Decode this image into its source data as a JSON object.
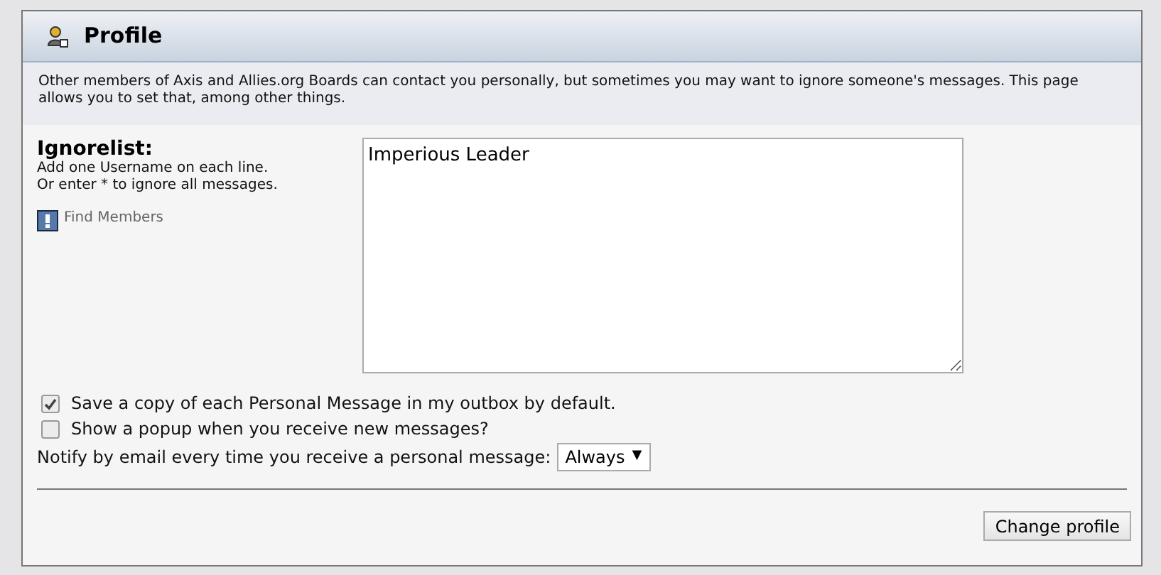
{
  "panel": {
    "title": "Profile",
    "intro": "Other members of Axis and Allies.org Boards can contact you personally, but sometimes you may want to ignore someone's messages. This page allows you to set that, among other things."
  },
  "ignorelist": {
    "label": "Ignorelist:",
    "hints": [
      "Add one Username on each line.",
      "Or enter * to ignore all messages."
    ],
    "find_link": "Find Members",
    "value": "Imperious Leader"
  },
  "options": [
    {
      "label": "Save a copy of each Personal Message in my outbox by default.",
      "checked": true
    },
    {
      "label": "Show a popup when you receive new messages?",
      "checked": false
    }
  ],
  "notify": {
    "label": "Notify by email every time you receive a personal message:",
    "value": "Always",
    "arrow": "▼"
  },
  "submit": "Change profile"
}
